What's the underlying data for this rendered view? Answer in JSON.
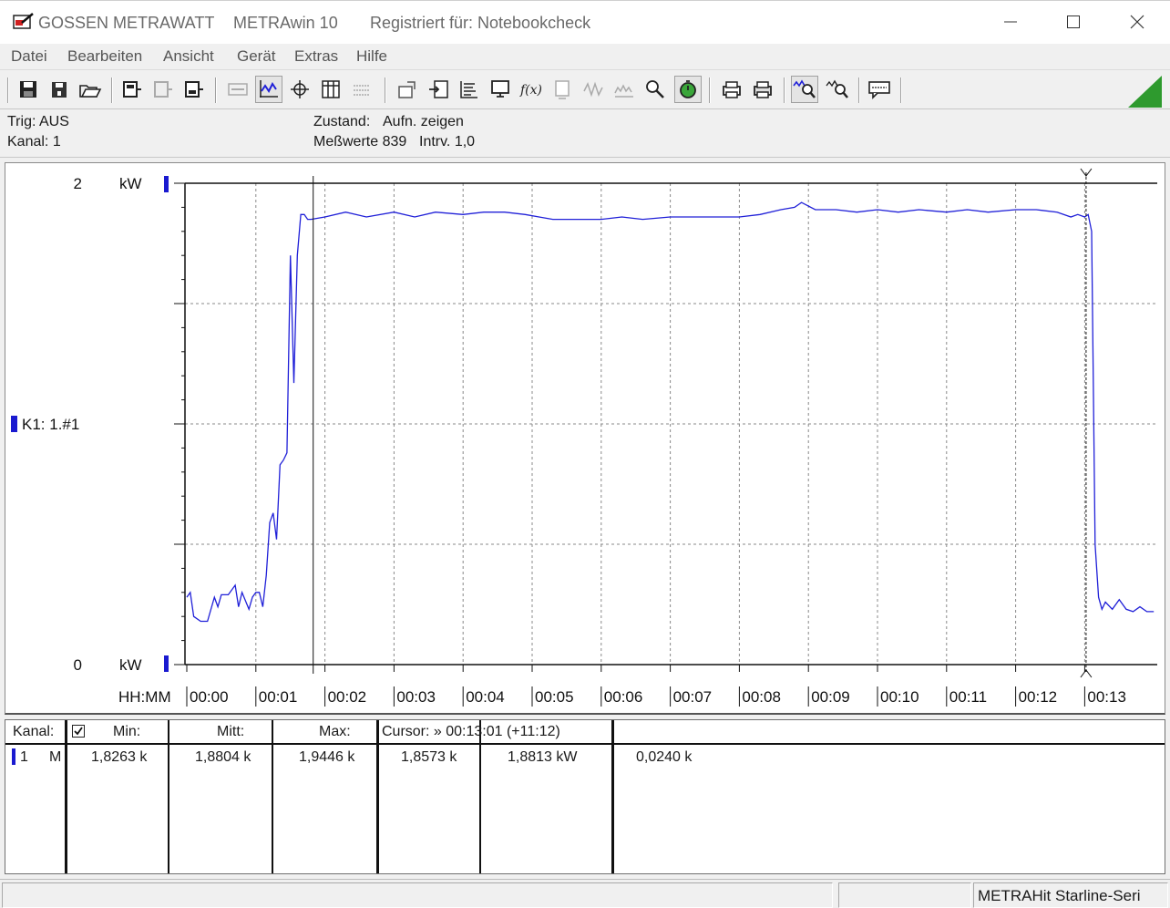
{
  "titlebar": {
    "company": "GOSSEN METRAWATT",
    "app": "METRAwin 10",
    "registered": "Registriert für: Notebookcheck"
  },
  "menu": [
    "Datei",
    "Bearbeiten",
    "Ansicht",
    "Gerät",
    "Extras",
    "Hilfe"
  ],
  "status": {
    "trig": "Trig: AUS",
    "kanal": "Kanal: 1",
    "zustand_label": "Zustand:",
    "zustand_value": "Aufn. zeigen",
    "messwerte": "Meßwerte 839",
    "intervall": "Intrv. 1,0"
  },
  "chart_data": {
    "type": "line",
    "channel_label": "K1: 1.#1",
    "y_unit_top": "kW",
    "y_unit_bottom": "kW",
    "y_top_label": "2",
    "y_bottom_label": "0",
    "ylim": [
      0,
      2
    ],
    "xlabel": "HH:MM",
    "x_ticks": [
      "00:00",
      "00:01",
      "00:02",
      "00:03",
      "00:04",
      "00:05",
      "00:06",
      "00:07",
      "00:08",
      "00:09",
      "00:10",
      "00:11",
      "00:12",
      "00:13"
    ],
    "grid": true,
    "series": [
      {
        "color": "#2020d8",
        "x_minutes": [
          0.0,
          0.05,
          0.1,
          0.2,
          0.3,
          0.4,
          0.45,
          0.5,
          0.6,
          0.7,
          0.75,
          0.8,
          0.9,
          0.95,
          1.0,
          1.05,
          1.1,
          1.15,
          1.2,
          1.25,
          1.3,
          1.35,
          1.4,
          1.45,
          1.5,
          1.55,
          1.6,
          1.65,
          1.7,
          1.75,
          1.8,
          2.0,
          2.3,
          2.6,
          3.0,
          3.3,
          3.6,
          4.0,
          4.3,
          4.6,
          4.9,
          5.1,
          5.3,
          5.6,
          6.0,
          6.3,
          6.6,
          7.0,
          7.3,
          7.6,
          8.0,
          8.3,
          8.6,
          8.8,
          8.9,
          9.1,
          9.4,
          9.7,
          10.0,
          10.3,
          10.6,
          11.0,
          11.3,
          11.6,
          12.0,
          12.3,
          12.6,
          12.8,
          12.9,
          13.0,
          13.05,
          13.1,
          13.15,
          13.2,
          13.25,
          13.3,
          13.4,
          13.5,
          13.6,
          13.7,
          13.8,
          13.9,
          14.0
        ],
        "values": [
          0.28,
          0.3,
          0.2,
          0.18,
          0.18,
          0.28,
          0.24,
          0.29,
          0.29,
          0.33,
          0.24,
          0.3,
          0.23,
          0.28,
          0.3,
          0.3,
          0.24,
          0.37,
          0.59,
          0.63,
          0.52,
          0.83,
          0.85,
          0.88,
          1.7,
          1.17,
          1.7,
          1.87,
          1.87,
          1.85,
          1.85,
          1.86,
          1.88,
          1.86,
          1.88,
          1.86,
          1.88,
          1.87,
          1.88,
          1.88,
          1.87,
          1.86,
          1.85,
          1.85,
          1.85,
          1.86,
          1.85,
          1.86,
          1.86,
          1.86,
          1.86,
          1.87,
          1.89,
          1.9,
          1.92,
          1.89,
          1.89,
          1.88,
          1.89,
          1.88,
          1.89,
          1.88,
          1.89,
          1.88,
          1.89,
          1.89,
          1.88,
          1.86,
          1.87,
          1.86,
          1.87,
          1.8,
          0.5,
          0.28,
          0.23,
          0.26,
          0.23,
          0.27,
          0.23,
          0.22,
          0.24,
          0.22,
          0.22
        ]
      }
    ],
    "cursor_1_minutes": 1.83,
    "cursor_2_minutes": 13.02
  },
  "table": {
    "headers": {
      "kanal": "Kanal:",
      "min": "Min:",
      "mitt": "Mitt:",
      "max": "Max:",
      "cursor": "Cursor: » 00:13:01 (+11:12)"
    },
    "row": {
      "num": "1",
      "mode": "M",
      "min": "1,8263 k",
      "mitt": "1,8804 k",
      "max": "1,9446 k",
      "c1": "1,8573  k",
      "c2": "1,8813  kW",
      "c3": "0,0240  k"
    }
  },
  "statusbar": {
    "device": "METRAHit Starline-Seri"
  },
  "colors": {
    "trace": "#2020d8",
    "marker": "#1a1ad0"
  }
}
